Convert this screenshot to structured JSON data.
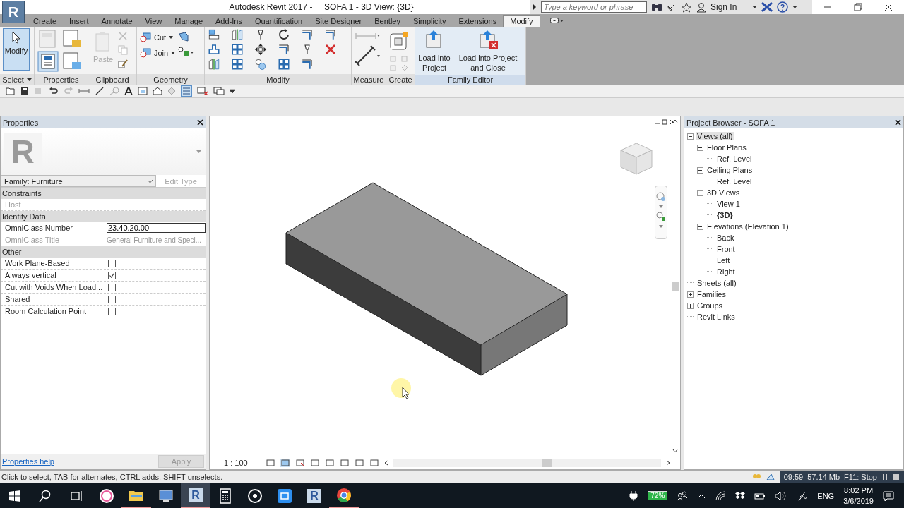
{
  "app": {
    "logo": "R",
    "title": "Autodesk Revit 2017 -",
    "document": "SOFA 1 - 3D View: {3D}"
  },
  "search": {
    "placeholder": "Type a keyword or phrase"
  },
  "sign_in": "Sign In",
  "tabs": [
    {
      "label": "Create",
      "selected": false
    },
    {
      "label": "Insert",
      "selected": false
    },
    {
      "label": "Annotate",
      "selected": false
    },
    {
      "label": "View",
      "selected": false
    },
    {
      "label": "Manage",
      "selected": false
    },
    {
      "label": "Add-Ins",
      "selected": false
    },
    {
      "label": "Quantification",
      "selected": false
    },
    {
      "label": "Site Designer",
      "selected": false
    },
    {
      "label": "Bentley",
      "selected": false
    },
    {
      "label": "Simplicity",
      "selected": false
    },
    {
      "label": "Extensions",
      "selected": false
    },
    {
      "label": "Modify",
      "selected": true
    }
  ],
  "ribbon": [
    {
      "kind": "select",
      "title": "Select",
      "tools": [
        {
          "label": "Modify",
          "selected": true
        }
      ]
    },
    {
      "kind": "properties",
      "title": "Properties"
    },
    {
      "kind": "clipboard",
      "title": "Clipboard",
      "tools": [
        {
          "label": "Paste"
        }
      ]
    },
    {
      "kind": "geometry",
      "title": "Geometry",
      "tools": [
        {
          "label": "Cut"
        },
        {
          "label": "Join"
        }
      ]
    },
    {
      "kind": "modify",
      "title": "Modify"
    },
    {
      "kind": "measure",
      "title": "Measure"
    },
    {
      "kind": "create",
      "title": "Create"
    },
    {
      "kind": "family",
      "title": "Family Editor",
      "tools": [
        {
          "label": "Load into Project"
        },
        {
          "label": "Load into Project and Close"
        }
      ]
    }
  ],
  "properties": {
    "title": "Properties",
    "preview_letter": "R",
    "type_selector": "Family: Furniture",
    "edit_type": "Edit Type",
    "groups": [
      {
        "name": "Constraints",
        "rows": [
          {
            "kind": "text",
            "label": "Host",
            "value": "",
            "disabled": true
          }
        ]
      },
      {
        "name": "Identity Data",
        "rows": [
          {
            "kind": "input",
            "label": "OmniClass Number",
            "value": "23.40.20.00",
            "disabled": false
          },
          {
            "kind": "text",
            "label": "OmniClass Title",
            "value": "General Furniture and Speci...",
            "disabled": true
          }
        ]
      },
      {
        "name": "Other",
        "rows": [
          {
            "kind": "check",
            "label": "Work Plane-Based",
            "checked": false,
            "disabled": false
          },
          {
            "kind": "check",
            "label": "Always vertical",
            "checked": true,
            "disabled": false
          },
          {
            "kind": "check",
            "label": "Cut with Voids When Load...",
            "checked": false,
            "disabled": false
          },
          {
            "kind": "check",
            "label": "Shared",
            "checked": false,
            "disabled": false
          },
          {
            "kind": "check",
            "label": "Room Calculation Point",
            "checked": false,
            "disabled": false
          }
        ]
      }
    ],
    "help": "Properties help",
    "apply": "Apply"
  },
  "view": {
    "scale": "1 : 100"
  },
  "browser": {
    "title": "Project Browser - SOFA 1",
    "tree": [
      {
        "kind": "group",
        "label": "Views (all)",
        "expanded": true,
        "selected": true,
        "current": false,
        "children": [
          {
            "kind": "group",
            "label": "Floor Plans",
            "expanded": true,
            "selected": false,
            "current": false,
            "children": [
              {
                "kind": "leaf",
                "label": "Ref. Level",
                "selected": false,
                "current": false
              }
            ]
          },
          {
            "kind": "group",
            "label": "Ceiling Plans",
            "expanded": true,
            "selected": false,
            "current": false,
            "children": [
              {
                "kind": "leaf",
                "label": "Ref. Level",
                "selected": false,
                "current": false
              }
            ]
          },
          {
            "kind": "group",
            "label": "3D Views",
            "expanded": true,
            "selected": false,
            "current": false,
            "children": [
              {
                "kind": "leaf",
                "label": "View 1",
                "selected": false,
                "current": false
              },
              {
                "kind": "leaf",
                "label": "{3D}",
                "selected": false,
                "current": true
              }
            ]
          },
          {
            "kind": "group",
            "label": "Elevations (Elevation 1)",
            "expanded": true,
            "selected": false,
            "current": false,
            "children": [
              {
                "kind": "leaf",
                "label": "Back",
                "selected": false,
                "current": false
              },
              {
                "kind": "leaf",
                "label": "Front",
                "selected": false,
                "current": false
              },
              {
                "kind": "leaf",
                "label": "Left",
                "selected": false,
                "current": false
              },
              {
                "kind": "leaf",
                "label": "Right",
                "selected": false,
                "current": false
              }
            ]
          }
        ]
      },
      {
        "kind": "leaf",
        "label": "Sheets (all)",
        "selected": false,
        "current": false
      },
      {
        "kind": "group",
        "label": "Families",
        "expanded": false,
        "selected": false,
        "current": false
      },
      {
        "kind": "group",
        "label": "Groups",
        "expanded": false,
        "selected": false,
        "current": false
      },
      {
        "kind": "leaf",
        "label": "Revit Links",
        "selected": false,
        "current": false
      }
    ]
  },
  "status": {
    "message": "Click to select, TAB for alternates, CTRL adds, SHIFT unselects.",
    "recorder": [
      "09:59",
      "57.14 Mb",
      "F11: Stop"
    ]
  },
  "taskbar": {
    "apps": [
      {
        "kind": "music",
        "running": false,
        "selected": false
      },
      {
        "kind": "folder",
        "running": true,
        "selected": false
      },
      {
        "kind": "monitor",
        "running": false,
        "selected": false
      },
      {
        "kind": "revit",
        "label": "R",
        "running": true,
        "selected": true
      },
      {
        "kind": "calculator",
        "running": false,
        "selected": false
      },
      {
        "kind": "disc",
        "running": false,
        "selected": false
      },
      {
        "kind": "capture",
        "running": false,
        "selected": false
      },
      {
        "kind": "revit",
        "label": "R",
        "running": false,
        "selected": false
      },
      {
        "kind": "chrome",
        "running": true,
        "selected": false
      }
    ],
    "battery": "72%",
    "language": "ENG",
    "time": "8:02 PM",
    "date": "3/6/2019"
  }
}
